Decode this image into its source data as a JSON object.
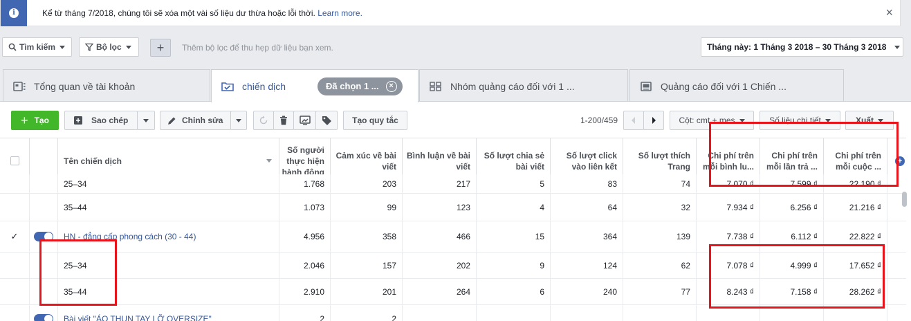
{
  "notice": {
    "message": "Kể từ tháng 7/2018, chúng tôi sẽ xóa một vài số liệu dư thừa hoặc lỗi thời.",
    "link": "Learn more.",
    "close": "×"
  },
  "filterbar": {
    "search_label": "Tìm kiếm",
    "filter_label": "Bộ lọc",
    "add_label": "+",
    "hint": "Thêm bộ lọc để thu hẹp dữ liệu bạn xem.",
    "date_range": "Tháng này: 1 Tháng 3 2018 – 30 Tháng 3 2018"
  },
  "tabs": [
    {
      "label": "Tổng quan về tài khoản"
    },
    {
      "label": "chiến dịch",
      "pill": "Đã chọn 1 ...",
      "pill_close": "×"
    },
    {
      "label": "Nhóm quảng cáo đối với 1 ..."
    },
    {
      "label": "Quảng cáo đối với 1 Chiến ..."
    }
  ],
  "toolbar": {
    "create_label": "Tạo",
    "copy_label": "Sao chép",
    "edit_label": "Chỉnh sửa",
    "rules_label": "Tạo quy tắc",
    "pagination": "1-200/459",
    "columns_label": "Cột: cmt + mes",
    "breakdown_label": "Số liệu chi tiết",
    "export_label": "Xuất"
  },
  "table": {
    "name_header": "Tên chiến dịch",
    "headers": [
      "Số người thực hiện hành động",
      "Cảm xúc về bài viết",
      "Bình luận về bài viết",
      "Số lượt chia sẻ bài viết",
      "Số lượt click vào liên kết",
      "Số lượt thích Trang",
      "Chi phí trên mỗi bình lu...",
      "Chi phí trên mỗi lần trả ...",
      "Chi phí trên mỗi cuộc ..."
    ],
    "rows": [
      {
        "name": "25–34",
        "values": [
          "1.768",
          "203",
          "217",
          "5",
          "83",
          "74",
          "7.070 ₫",
          "7.599 ₫",
          "22.190 ₫"
        ]
      },
      {
        "name": "35–44",
        "values": [
          "1.073",
          "99",
          "123",
          "4",
          "64",
          "32",
          "7.934 ₫",
          "6.256 ₫",
          "21.216 ₫"
        ]
      },
      {
        "name": "HN - đẳng cấp phong cách (30 - 44)",
        "values": [
          "4.956",
          "358",
          "466",
          "15",
          "364",
          "139",
          "7.738 ₫",
          "6.112 ₫",
          "22.822 ₫"
        ],
        "checked": true,
        "toggle": true,
        "link": true
      },
      {
        "name": "25–34",
        "values": [
          "2.046",
          "157",
          "202",
          "9",
          "124",
          "62",
          "7.078 ₫",
          "4.999 ₫",
          "17.652 ₫"
        ]
      },
      {
        "name": "35–44",
        "values": [
          "2.910",
          "201",
          "264",
          "6",
          "240",
          "77",
          "8.243 ₫",
          "7.158 ₫",
          "28.262 ₫"
        ]
      },
      {
        "name": "Bài viết \"ÁO THUN TAY LỠ OVERSIZE\"",
        "values": [
          "2",
          "2",
          "",
          "",
          "",
          "",
          "",
          "",
          ""
        ],
        "toggle": true,
        "link": true
      }
    ]
  },
  "colors": {
    "accent": "#4267b2",
    "link": "#365899",
    "create": "#42b72a",
    "annotation": "#e8141b"
  }
}
